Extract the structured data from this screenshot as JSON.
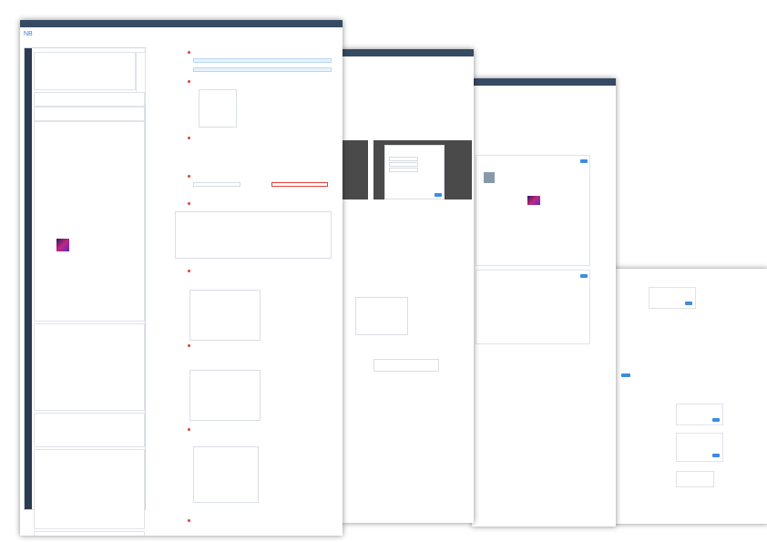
{
  "back_doc": {
    "header_title": "",
    "modal_title": "",
    "buttons": [
      "",
      ""
    ]
  },
  "mid_doc": {
    "header_title": "",
    "right_title": ""
  },
  "main_doc": {
    "logo": "NB",
    "header_title": "",
    "header_right": "",
    "sections": [],
    "notes": []
  },
  "colors": {
    "header": "#364a63",
    "accent": "#3b8de0",
    "annotation": "#e0403a",
    "sidebar": "#2c3b50"
  }
}
